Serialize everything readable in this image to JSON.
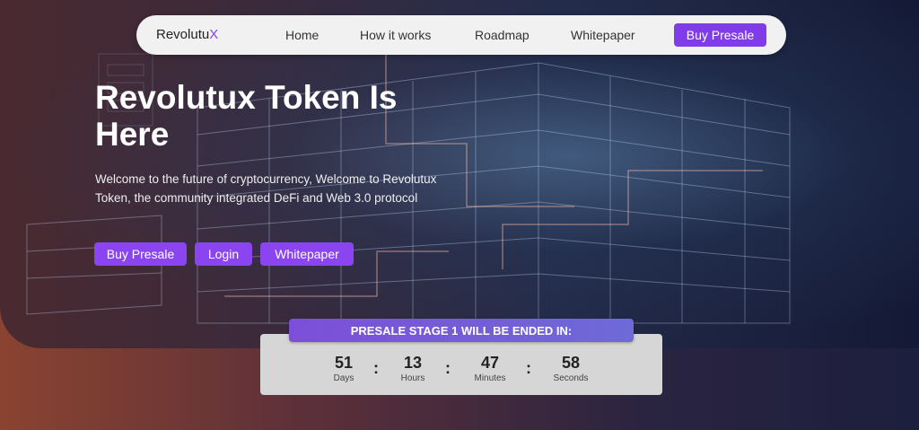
{
  "nav": {
    "brand_main": "Revolutu",
    "brand_accent": "X",
    "links": [
      "Home",
      "How it works",
      "Roadmap",
      "Whitepaper"
    ],
    "cta": "Buy Presale"
  },
  "hero": {
    "title_line1": "Revolutux Token Is",
    "title_line2": "Here",
    "subtitle": "Welcome to the future of cryptocurrency, Welcome to Revolutux Token, the community integrated DeFi and Web 3.0 protocol",
    "buttons": [
      "Buy Presale",
      "Login",
      "Whitepaper"
    ]
  },
  "presale": {
    "banner": "PRESALE STAGE 1 WILL BE ENDED IN:",
    "countdown": [
      {
        "value": "51",
        "label": "Days"
      },
      {
        "value": "13",
        "label": "Hours"
      },
      {
        "value": "47",
        "label": "Minutes"
      },
      {
        "value": "58",
        "label": "Seconds"
      }
    ]
  },
  "colors": {
    "accent": "#8b45f0",
    "nav_bg": "#f1f1f1",
    "countdown_bg": "#d6d6d6"
  }
}
